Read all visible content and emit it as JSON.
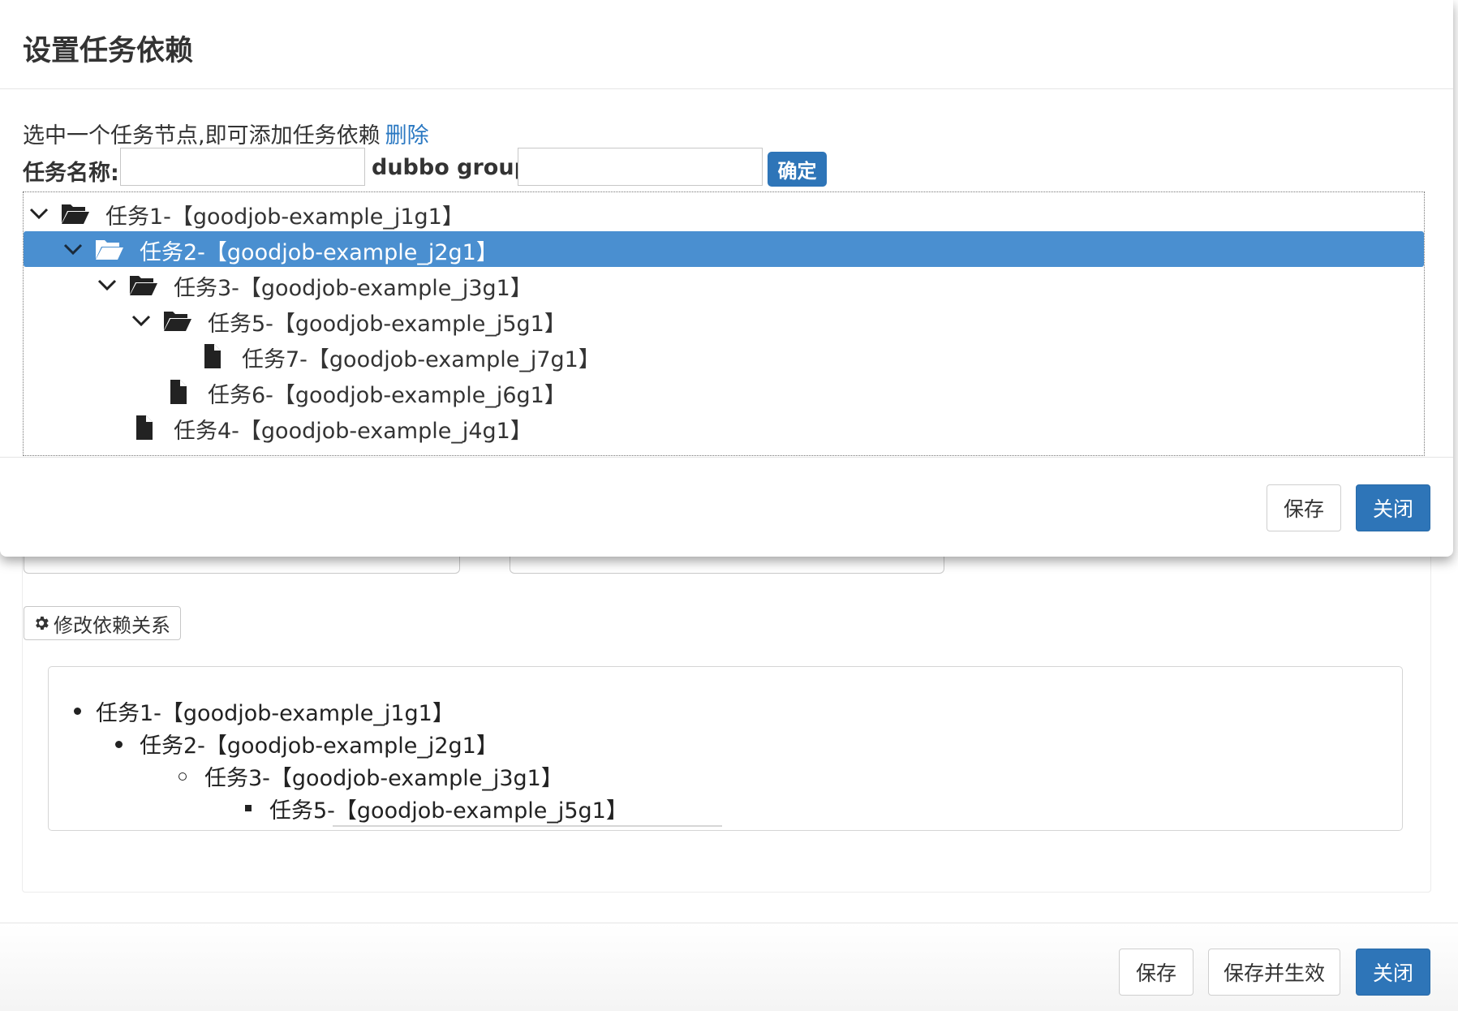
{
  "modal": {
    "title": "设置任务依赖",
    "hint_text": "选中一个任务节点,即可添加任务依赖",
    "delete_link": "删除",
    "task_name_label": "任务名称:",
    "task_name_value": "",
    "group_label": "dubbo group:",
    "group_value": "",
    "confirm_label": "确定",
    "tree": [
      {
        "label": "任务1-【goodjob-example_j1g1】",
        "expanded": true,
        "folder": true,
        "level": 0,
        "selected": false
      },
      {
        "label": "任务2-【goodjob-example_j2g1】",
        "expanded": true,
        "folder": true,
        "level": 1,
        "selected": true
      },
      {
        "label": "任务3-【goodjob-example_j3g1】",
        "expanded": true,
        "folder": true,
        "level": 2,
        "selected": false
      },
      {
        "label": "任务5-【goodjob-example_j5g1】",
        "expanded": true,
        "folder": true,
        "level": 3,
        "selected": false
      },
      {
        "label": "任务7-【goodjob-example_j7g1】",
        "expanded": false,
        "folder": false,
        "level": 4,
        "selected": false
      },
      {
        "label": "任务6-【goodjob-example_j6g1】",
        "expanded": false,
        "folder": false,
        "level": 3,
        "selected": false
      },
      {
        "label": "任务4-【goodjob-example_j4g1】",
        "expanded": false,
        "folder": false,
        "level": 2,
        "selected": false
      }
    ],
    "save_label": "保存",
    "close_label": "关闭"
  },
  "page": {
    "edit_dependency_label": "修改依赖关系",
    "edit_dependency_icon": "gear-icon",
    "preview": [
      {
        "label": "任务1-【goodjob-example_j1g1】",
        "bullet": "disc"
      },
      {
        "label": "任务2-【goodjob-example_j2g1】",
        "bullet": "disc"
      },
      {
        "label": "任务3-【goodjob-example_j3g1】",
        "bullet": "circle"
      },
      {
        "label": "任务5-【goodjob-example_j5g1】",
        "bullet": "square"
      }
    ],
    "footer": {
      "save_label": "保存",
      "save_apply_label": "保存并生效",
      "close_label": "关闭"
    }
  },
  "colors": {
    "primary": "#2e75b8",
    "selected_row": "#4a8fd0",
    "link": "#2a78c2"
  }
}
